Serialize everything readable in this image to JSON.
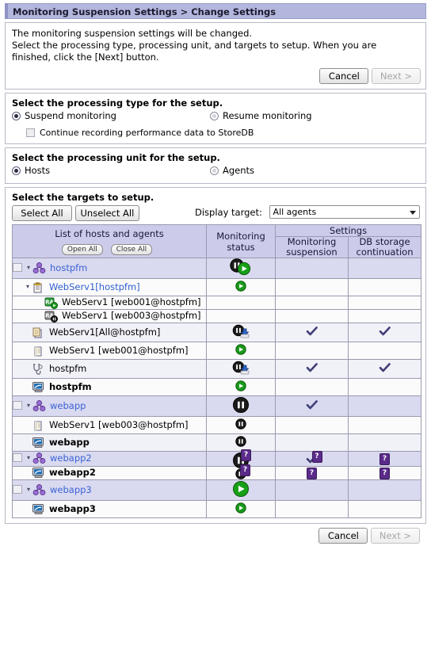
{
  "window": {
    "title": "Monitoring Suspension Settings > Change Settings"
  },
  "intro": {
    "line1": "The monitoring suspension settings will be changed.",
    "line2": "Select the processing type, processing unit, and targets to setup. When you are",
    "line3": "finished, click the [Next] button."
  },
  "top_buttons": {
    "cancel": "Cancel",
    "next": "Next >"
  },
  "bottom_buttons": {
    "cancel": "Cancel",
    "next": "Next >"
  },
  "processing_type": {
    "title": "Select the processing type for the setup.",
    "option_suspend": "Suspend monitoring",
    "option_resume": "Resume monitoring",
    "checkbox_storedb": "Continue recording performance data to StoreDB",
    "suspend_selected": true,
    "resume_selected": false,
    "storedb_checked": false
  },
  "processing_unit": {
    "title": "Select the processing unit for the setup.",
    "option_hosts": "Hosts",
    "option_agents": "Agents",
    "hosts_selected": true,
    "agents_selected": false
  },
  "targets": {
    "title": "Select the targets to setup.",
    "select_all": "Select All",
    "unselect_all": "Unselect All",
    "display_target_label": "Display target:",
    "display_target_value": "All agents",
    "display_target_options": [
      "All agents"
    ],
    "open_all": "Open All",
    "close_all": "Close All",
    "columns": {
      "list": "List of hosts and agents",
      "monitoring_status": "Monitoring status",
      "monitoring_status_l1": "Monitoring",
      "monitoring_status_l2": "status",
      "settings": "Settings",
      "monitoring_suspension_l1": "Monitoring",
      "monitoring_suspension_l2": "suspension",
      "db_storage_l1": "DB storage",
      "db_storage_l2": "continuation"
    },
    "rows": [
      {
        "label": "hostpfm",
        "indent": 0,
        "style": "group",
        "link": true,
        "checkbox": true,
        "twisty": "down",
        "icon": "host-group-icon",
        "status": "pause-play-icon",
        "suspension": "",
        "db": ""
      },
      {
        "label": "WebServ1[hostpfm]<RM Platform>",
        "indent": 1,
        "style": "plain",
        "link": true,
        "checkbox": false,
        "twisty": "down",
        "icon": "rm-platform-book-icon",
        "status": "play-icon",
        "suspension": "",
        "db": ""
      },
      {
        "label": "WebServ1 [web001@hostpfm]<RM Platform>",
        "indent": 2,
        "style": "plain",
        "link": false,
        "checkbox": false,
        "twisty": "",
        "icon": "ra-agent-play-icon",
        "status": "",
        "suspension": "",
        "db": ""
      },
      {
        "label": "WebServ1 [web003@hostpfm]<RM Platform>",
        "indent": 2,
        "style": "plain",
        "link": false,
        "checkbox": false,
        "twisty": "",
        "icon": "ra-agent-pause-icon",
        "status": "",
        "suspension": "",
        "db": ""
      },
      {
        "label": "WebServ1[All@hostpfm] <RM Platform>",
        "indent": 1,
        "style": "alt",
        "link": false,
        "checkbox": false,
        "twisty": "",
        "icon": "rm-platform-all-icon",
        "status": "pause-db-icon",
        "suspension": "check",
        "db": "check"
      },
      {
        "label": "WebServ1 [web001@hostpfm]<RM Platform>",
        "indent": 1,
        "style": "plain",
        "link": false,
        "checkbox": false,
        "twisty": "",
        "icon": "rm-platform-plain-icon",
        "status": "play-icon",
        "suspension": "",
        "db": ""
      },
      {
        "label": "hostpfm<HealthCheck>",
        "indent": 1,
        "style": "alt",
        "link": false,
        "checkbox": false,
        "twisty": "",
        "icon": "healthcheck-stethoscope-icon",
        "status": "pause-db-icon",
        "suspension": "check",
        "db": "check"
      },
      {
        "label": "hostpfm<Windows>",
        "indent": 1,
        "style": "plain",
        "link": false,
        "bold": true,
        "checkbox": false,
        "twisty": "",
        "icon": "windows-agent-icon",
        "status": "play-icon",
        "suspension": "",
        "db": ""
      },
      {
        "label": "webapp",
        "indent": 0,
        "style": "group",
        "link": true,
        "checkbox": true,
        "twisty": "down",
        "icon": "host-group-icon",
        "status": "pause-big-icon",
        "suspension": "check",
        "db": ""
      },
      {
        "label": "WebServ1 [web003@hostpfm]<RM Platform>",
        "indent": 1,
        "style": "plain",
        "link": false,
        "checkbox": false,
        "twisty": "",
        "icon": "rm-platform-plain-icon",
        "status": "pause-small-icon",
        "suspension": "",
        "db": ""
      },
      {
        "label": "webapp<Windows>",
        "indent": 1,
        "style": "alt",
        "link": false,
        "bold": true,
        "checkbox": false,
        "twisty": "",
        "icon": "windows-agent-icon",
        "status": "pause-small-icon",
        "suspension": "",
        "db": ""
      },
      {
        "label": "webapp2",
        "indent": 0,
        "style": "group",
        "link": true,
        "checkbox": true,
        "twisty": "down",
        "icon": "host-group-icon",
        "status": "pause-big-question-icon",
        "suspension": "check-question",
        "db": "question"
      },
      {
        "label": "webapp2<Windows>",
        "indent": 1,
        "style": "plain",
        "link": false,
        "bold": true,
        "checkbox": false,
        "twisty": "",
        "icon": "windows-agent-icon",
        "status": "pause-small-question-icon",
        "suspension": "question",
        "db": "question"
      },
      {
        "label": "webapp3",
        "indent": 0,
        "style": "group",
        "link": true,
        "checkbox": true,
        "twisty": "down",
        "icon": "host-group-icon",
        "status": "play-big-icon",
        "suspension": "",
        "db": ""
      },
      {
        "label": "webapp3<Windows>",
        "indent": 1,
        "style": "plain",
        "link": false,
        "bold": true,
        "checkbox": false,
        "twisty": "",
        "icon": "windows-agent-icon",
        "status": "play-icon",
        "suspension": "",
        "db": ""
      }
    ]
  },
  "colors": {
    "title_bar": "#b3b6dd",
    "table_header": "#ccccea",
    "group_row": "#d9d9f0",
    "alt_row": "#f1f1f8",
    "link": "#2f5fd0",
    "check": "#3f3f77",
    "badge": "#5b2b8a",
    "play_green": "#159015",
    "pause_black": "#1c1c1c"
  }
}
